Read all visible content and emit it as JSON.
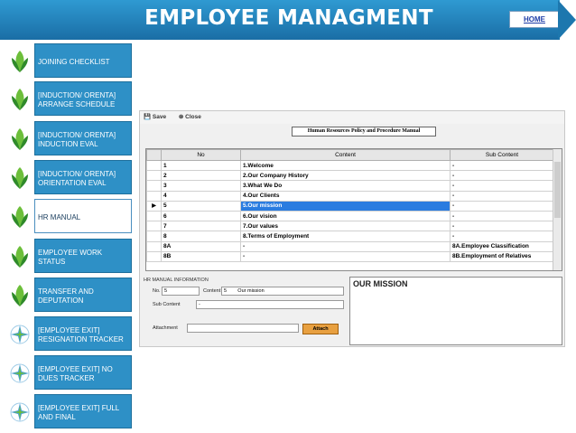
{
  "header": {
    "title": "EMPLOYEE MANAGMENT",
    "home_label": "HOME"
  },
  "colors": {
    "banner": "#2a86c0",
    "nav_bg": "#2e90c6",
    "selected_row": "#2a7ce0",
    "attach_button": "#e8a040"
  },
  "sidebar": {
    "items": [
      {
        "label": "JOINING CHECKLIST",
        "icon": "leaf-icon",
        "active": false
      },
      {
        "label": "[INDUCTION/ ORENTA] ARRANGE SCHEDULE",
        "icon": "leaf-icon",
        "active": false
      },
      {
        "label": "[INDUCTION/ ORENTA] INDUCTION EVAL",
        "icon": "leaf-icon",
        "active": false
      },
      {
        "label": "[INDUCTION/ ORENTA] ORIENTATION EVAL",
        "icon": "leaf-icon",
        "active": false
      },
      {
        "label": "HR MANUAL",
        "icon": "leaf-icon",
        "active": true
      },
      {
        "label": "EMPLOYEE WORK STATUS",
        "icon": "leaf-icon",
        "active": false
      },
      {
        "label": "TRANSFER AND DEPUTATION",
        "icon": "leaf-icon",
        "active": false
      },
      {
        "label": "[EMPLOYEE EXIT] RESIGNATION TRACKER",
        "icon": "star-icon",
        "active": false
      },
      {
        "label": "[EMPLOYEE EXIT] NO DUES TRACKER",
        "icon": "star-icon",
        "active": false
      },
      {
        "label": "[EMPLOYEE EXIT] FULL AND FINAL",
        "icon": "star-icon",
        "active": false
      }
    ]
  },
  "app": {
    "toolbar": {
      "save": "Save",
      "close": "Close"
    },
    "manual_title": "Human Resources Policy and Procedure Manual",
    "grid": {
      "columns": [
        "No",
        "Content",
        "Sub Content"
      ],
      "rows": [
        {
          "no": "1",
          "content": "1.Welcome",
          "sub": "-"
        },
        {
          "no": "2",
          "content": "2.Our Company History",
          "sub": "-"
        },
        {
          "no": "3",
          "content": "3.What We Do",
          "sub": "-"
        },
        {
          "no": "4",
          "content": " 4.Our Clients",
          "sub": "-"
        },
        {
          "no": "5",
          "content": "5.Our mission",
          "sub": "-",
          "selected": true
        },
        {
          "no": "6",
          "content": "6.Our vision",
          "sub": "-"
        },
        {
          "no": "7",
          "content": "7.Our values",
          "sub": "-"
        },
        {
          "no": "8",
          "content": "8.Terms of Employment",
          "sub": "-"
        },
        {
          "no": "8A",
          "content": "-",
          "sub": "8A.Employee Classification"
        },
        {
          "no": "8B",
          "content": "-",
          "sub": "8B.Employment of Relatives"
        }
      ]
    },
    "form": {
      "section_label": "HR MANUAL INFORMATION",
      "no_label": "No.",
      "no_value": "5",
      "content_label": "Content",
      "content_no": "5",
      "content_value": "Our mission",
      "sub_label": "Sub Content",
      "sub_value": "-",
      "attachment_label": "Attachment",
      "attachment_value": "",
      "attach_button": "Attach"
    },
    "mission_text": "OUR MISSION"
  }
}
